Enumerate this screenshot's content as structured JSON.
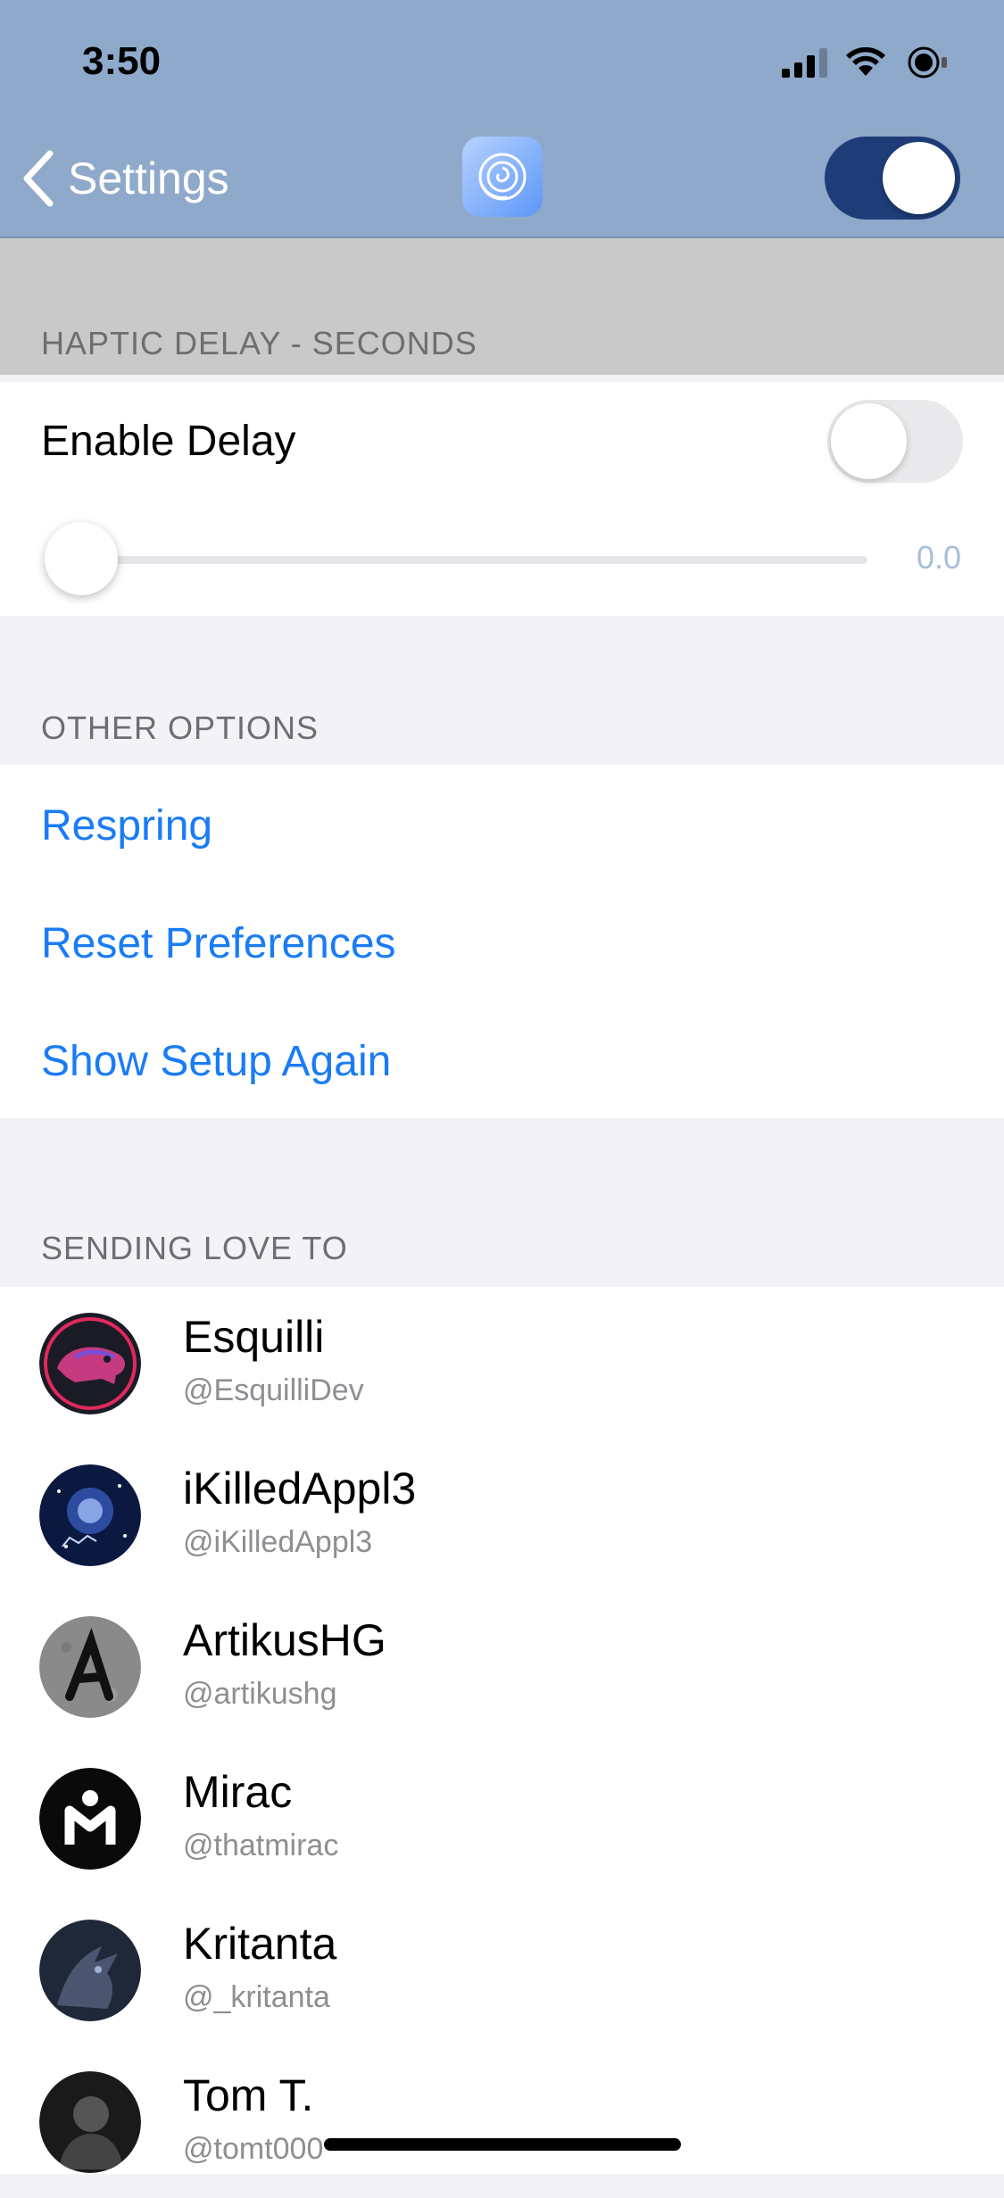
{
  "status_bar": {
    "time": "3:50"
  },
  "nav": {
    "back_label": "Settings",
    "app_icon": "rose-icon",
    "master_toggle_on": true
  },
  "haptic": {
    "header": "HAPTIC DELAY - SECONDS",
    "enable_label": "Enable Delay",
    "enable_on": false,
    "slider_value": "0.0"
  },
  "other": {
    "header": "OTHER OPTIONS",
    "items": [
      "Respring",
      "Reset Preferences",
      "Show Setup Again"
    ]
  },
  "love": {
    "header": "SENDING LOVE TO",
    "people": [
      {
        "name": "Esquilli",
        "handle": "@EsquilliDev"
      },
      {
        "name": "iKilledAppl3",
        "handle": "@iKilledAppl3"
      },
      {
        "name": "ArtikusHG",
        "handle": "@artikushg"
      },
      {
        "name": "Mirac",
        "handle": "@thatmirac"
      },
      {
        "name": "Kritanta",
        "handle": "@_kritanta"
      },
      {
        "name": "Tom T.",
        "handle": "@tomt000"
      }
    ]
  },
  "colors": {
    "nav_bg": "#8fa9ca",
    "accent_link": "#1a7cf5",
    "toggle_on": "#1e3c78"
  }
}
